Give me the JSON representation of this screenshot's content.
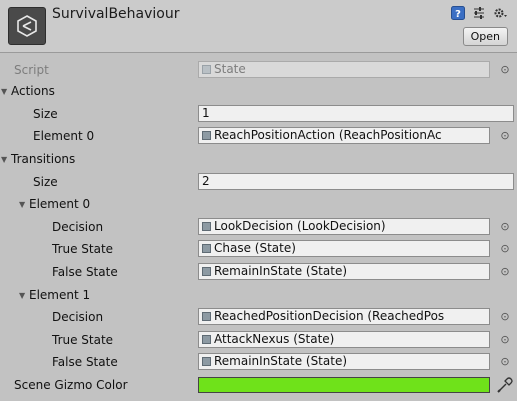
{
  "header": {
    "title": "SurvivalBehaviour",
    "open_label": "Open",
    "icons": [
      "unity-logo-icon",
      "help-icon",
      "settings-sliders-icon",
      "gear-icon"
    ]
  },
  "script": {
    "label": "Script",
    "value": "State"
  },
  "actions": {
    "label": "Actions",
    "size_label": "Size",
    "size_value": "1",
    "element0_label": "Element 0",
    "element0_value": "ReachPositionAction (ReachPositionAc"
  },
  "transitions": {
    "label": "Transitions",
    "size_label": "Size",
    "size_value": "2",
    "elements": [
      {
        "label": "Element 0",
        "decision_label": "Decision",
        "decision_value": "LookDecision (LookDecision)",
        "true_label": "True State",
        "true_value": "Chase (State)",
        "false_label": "False State",
        "false_value": "RemainInState (State)"
      },
      {
        "label": "Element 1",
        "decision_label": "Decision",
        "decision_value": "ReachedPositionDecision (ReachedPos",
        "true_label": "True State",
        "true_value": "AttackNexus (State)",
        "false_label": "False State",
        "false_value": "RemainInState (State)"
      }
    ]
  },
  "gizmo": {
    "label": "Scene Gizmo Color",
    "color": "#6fe21a"
  },
  "colors": {
    "panel_bg": "#c2c2c2",
    "field_bg": "#f0f0f0",
    "accent_green": "#6fe21a"
  }
}
